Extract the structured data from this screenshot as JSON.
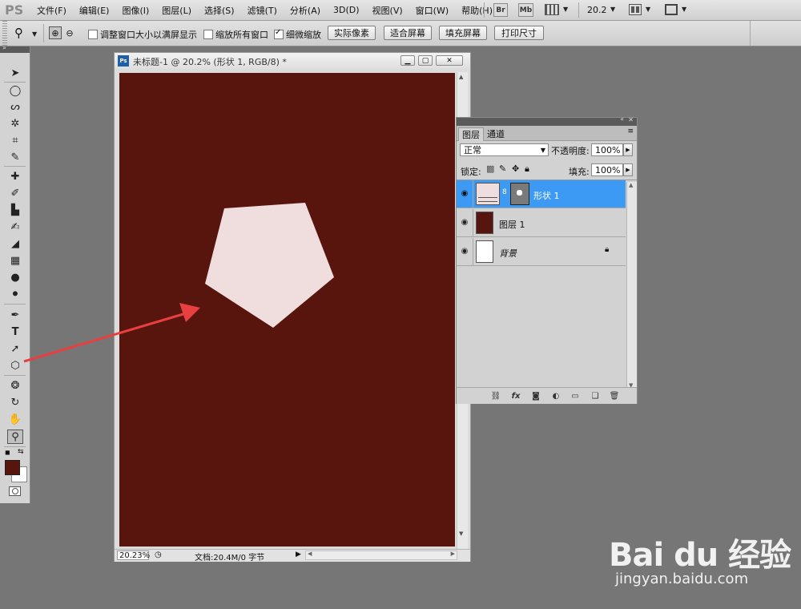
{
  "app": {
    "logo": "PS"
  },
  "menu": [
    "文件(F)",
    "编辑(E)",
    "图像(I)",
    "图层(L)",
    "选择(S)",
    "滤镜(T)",
    "分析(A)",
    "3D(D)",
    "视图(V)",
    "窗口(W)",
    "帮助(H)"
  ],
  "menubar": {
    "bridge_label": "Br",
    "minibridge_label": "Mb",
    "zoom_value": "20.2"
  },
  "options": {
    "resize_windows_label": "调整窗口大小以满屏显示",
    "zoom_all_label": "缩放所有窗口",
    "scrubby_zoom_label": "细微缩放",
    "actual_pixels_label": "实际像素",
    "fit_screen_label": "适合屏幕",
    "fill_screen_label": "填充屏幕",
    "print_size_label": "打印尺寸",
    "resize_windows_checked": false,
    "zoom_all_checked": false,
    "scrubby_zoom_checked": true
  },
  "document": {
    "title": "未标题-1 @ 20.2% (形状 1, RGB/8) *",
    "zoom_readout": "20.23%",
    "doc_info": "文档:20.4M/0 字节",
    "canvas_color": "#57150d",
    "shape_color": "#f0dede"
  },
  "colors": {
    "foreground": "#57150d",
    "background": "#ffffff",
    "arrow": "#e84040",
    "selection": "#3d9af4"
  },
  "layers_panel": {
    "tabs": [
      "图层",
      "通道"
    ],
    "blend_mode": "正常",
    "opacity_label": "不透明度:",
    "opacity_value": "100%",
    "lock_label": "锁定:",
    "fill_label": "填充:",
    "fill_value": "100%",
    "layers": [
      {
        "name": "形状 1",
        "selected": true
      },
      {
        "name": "图层 1",
        "selected": false
      },
      {
        "name": "背景",
        "selected": false
      }
    ]
  },
  "watermark": {
    "brand": "Bai du 经验",
    "url": "jingyan.baidu.com"
  }
}
